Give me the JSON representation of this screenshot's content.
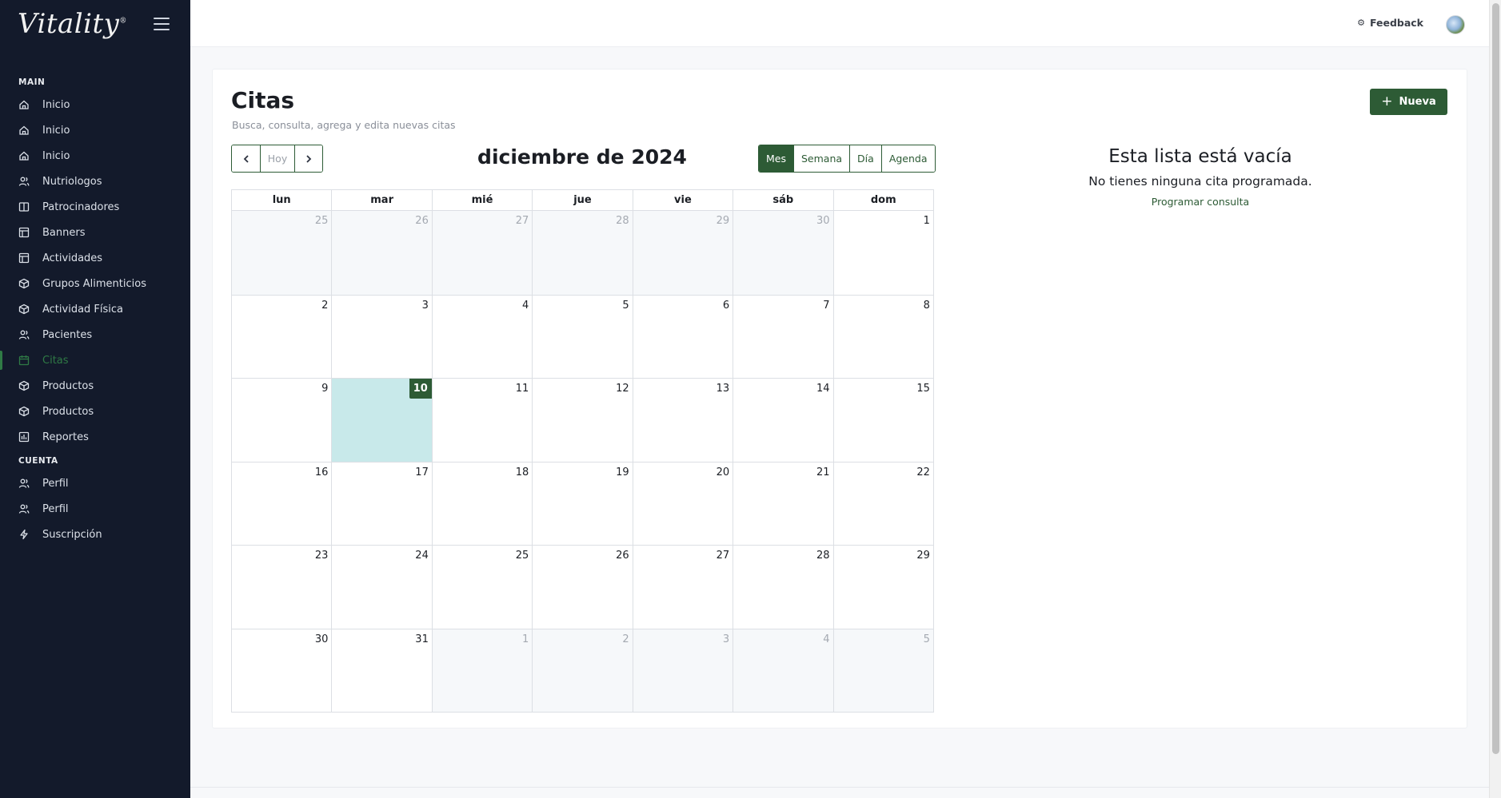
{
  "app": {
    "brand": "Vitality",
    "brand_mark": "®"
  },
  "sidebar": {
    "sections": [
      {
        "title": "MAIN"
      },
      {
        "title": "CUENTA"
      }
    ],
    "main_items": [
      {
        "label": "Inicio",
        "icon": "home-icon"
      },
      {
        "label": "Inicio",
        "icon": "home-icon"
      },
      {
        "label": "Inicio",
        "icon": "home-icon"
      },
      {
        "label": "Nutriologos",
        "icon": "users-icon"
      },
      {
        "label": "Patrocinadores",
        "icon": "book-icon"
      },
      {
        "label": "Banners",
        "icon": "layout-icon"
      },
      {
        "label": "Actividades",
        "icon": "layout-icon"
      },
      {
        "label": "Grupos Alimenticios",
        "icon": "box-icon"
      },
      {
        "label": "Actividad Física",
        "icon": "box-icon"
      },
      {
        "label": "Pacientes",
        "icon": "users-icon"
      },
      {
        "label": "Citas",
        "icon": "calendar-icon",
        "active": true
      },
      {
        "label": "Productos",
        "icon": "box-icon"
      },
      {
        "label": "Productos",
        "icon": "box-icon"
      },
      {
        "label": "Reportes",
        "icon": "report-icon"
      }
    ],
    "account_items": [
      {
        "label": "Perfil",
        "icon": "users-icon"
      },
      {
        "label": "Perfil",
        "icon": "users-icon"
      },
      {
        "label": "Suscripción",
        "icon": "bolt-icon"
      }
    ]
  },
  "topbar": {
    "feedback_label": "Feedback",
    "feedback_icon": "gear-icon"
  },
  "page": {
    "title": "Citas",
    "subtitle": "Busca, consulta, agrega y edita nuevas citas",
    "new_button": "Nueva"
  },
  "calendar": {
    "title": "diciembre de 2024",
    "today_label": "Hoy",
    "views": [
      "Mes",
      "Semana",
      "Día",
      "Agenda"
    ],
    "active_view": "Mes",
    "weekdays": [
      "lun",
      "mar",
      "mié",
      "jue",
      "vie",
      "sáb",
      "dom"
    ],
    "weeks": [
      [
        {
          "d": "25",
          "o": true
        },
        {
          "d": "26",
          "o": true
        },
        {
          "d": "27",
          "o": true
        },
        {
          "d": "28",
          "o": true
        },
        {
          "d": "29",
          "o": true
        },
        {
          "d": "30",
          "o": true
        },
        {
          "d": "1"
        }
      ],
      [
        {
          "d": "2"
        },
        {
          "d": "3"
        },
        {
          "d": "4"
        },
        {
          "d": "5"
        },
        {
          "d": "6"
        },
        {
          "d": "7"
        },
        {
          "d": "8"
        }
      ],
      [
        {
          "d": "9"
        },
        {
          "d": "10",
          "t": true
        },
        {
          "d": "11"
        },
        {
          "d": "12"
        },
        {
          "d": "13"
        },
        {
          "d": "14"
        },
        {
          "d": "15"
        }
      ],
      [
        {
          "d": "16"
        },
        {
          "d": "17"
        },
        {
          "d": "18"
        },
        {
          "d": "19"
        },
        {
          "d": "20"
        },
        {
          "d": "21"
        },
        {
          "d": "22"
        }
      ],
      [
        {
          "d": "23"
        },
        {
          "d": "24"
        },
        {
          "d": "25"
        },
        {
          "d": "26"
        },
        {
          "d": "27"
        },
        {
          "d": "28"
        },
        {
          "d": "29"
        }
      ],
      [
        {
          "d": "30"
        },
        {
          "d": "31"
        },
        {
          "d": "1",
          "o": true
        },
        {
          "d": "2",
          "o": true
        },
        {
          "d": "3",
          "o": true
        },
        {
          "d": "4",
          "o": true
        },
        {
          "d": "5",
          "o": true
        }
      ]
    ]
  },
  "empty_state": {
    "title": "Esta lista está vacía",
    "text": "No tienes ninguna cita programada.",
    "link": "Programar consulta"
  },
  "colors": {
    "accent": "#2d5b35",
    "sidebar_bg": "#131a2b",
    "today_bg": "#c8e9ea"
  }
}
